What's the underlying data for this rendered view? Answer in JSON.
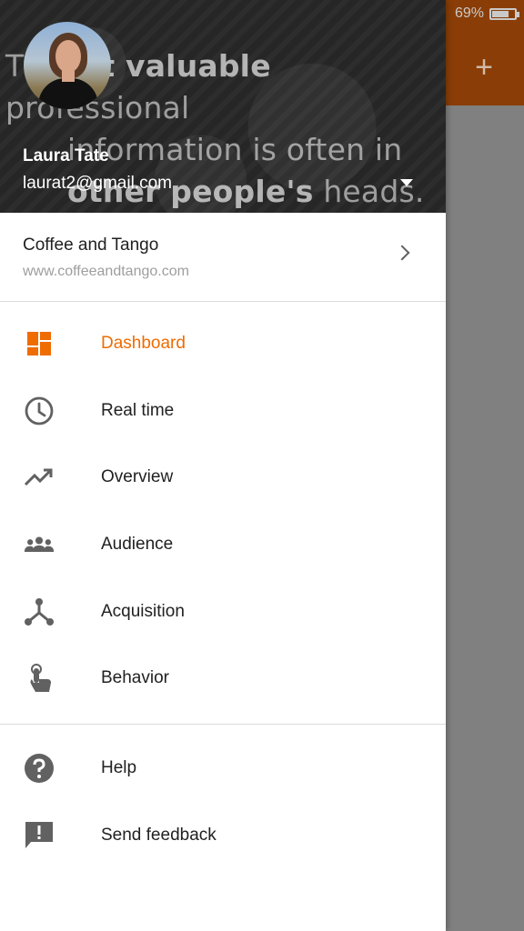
{
  "status": {
    "battery": "69%",
    "battery_level": 0.69
  },
  "background_appbar": {
    "add_icon": "plus-icon"
  },
  "header": {
    "quote_parts": [
      "T",
      "st valuable",
      " professional",
      "information is often in",
      "other people's",
      " heads."
    ],
    "user_name": "Laura Tate",
    "user_email": "laurat2@gmail.com"
  },
  "property": {
    "name": "Coffee and Tango",
    "url": "www.coffeeandtango.com"
  },
  "nav": {
    "primary": [
      {
        "label": "Dashboard",
        "icon": "dashboard-icon",
        "active": true
      },
      {
        "label": "Real time",
        "icon": "clock-icon"
      },
      {
        "label": "Overview",
        "icon": "trending-up-icon"
      },
      {
        "label": "Audience",
        "icon": "people-icon"
      },
      {
        "label": "Acquisition",
        "icon": "merge-icon"
      },
      {
        "label": "Behavior",
        "icon": "touch-icon"
      }
    ],
    "secondary": [
      {
        "label": "Help",
        "icon": "help-icon"
      },
      {
        "label": "Send feedback",
        "icon": "feedback-icon"
      }
    ]
  },
  "colors": {
    "accent": "#ef6c00",
    "icon_gray": "#616161",
    "appbar": "#8a3d06"
  }
}
